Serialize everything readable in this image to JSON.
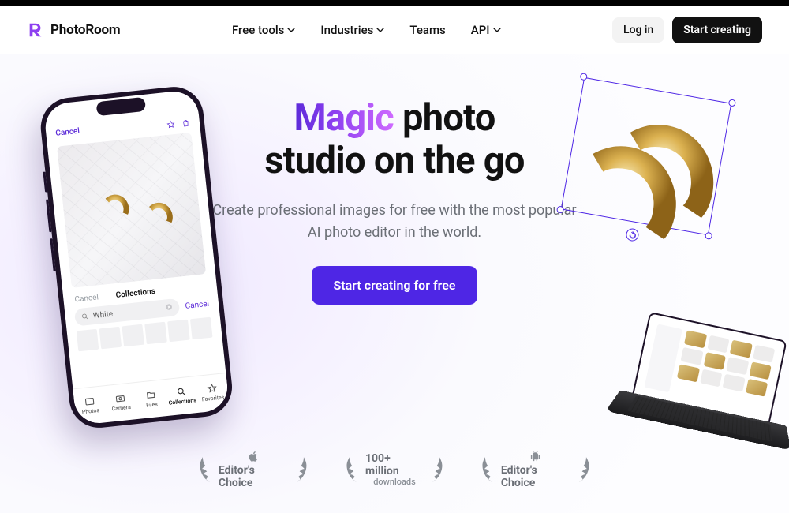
{
  "brand": {
    "name": "PhotoRoom"
  },
  "nav": {
    "items": [
      {
        "label": "Free tools",
        "dropdown": true
      },
      {
        "label": "Industries",
        "dropdown": true
      },
      {
        "label": "Teams",
        "dropdown": false
      },
      {
        "label": "API",
        "dropdown": true
      }
    ]
  },
  "auth": {
    "login": "Log in",
    "signup": "Start creating"
  },
  "hero": {
    "headline_accent": "Magic",
    "headline_rest_a": " photo",
    "headline_rest_b": "studio on the go",
    "sub_a": "Create professional images for free with the most popular",
    "sub_b": "AI photo editor in the world.",
    "cta": "Start creating for free"
  },
  "phone": {
    "cancel": "Cancel",
    "tab_a": "Cancel",
    "tab_b": "Collections",
    "search_value": "White",
    "search_trailing": "Cancel",
    "nav_items": [
      "Photos",
      "Camera",
      "Files",
      "Collections",
      "Favorites"
    ]
  },
  "badges": {
    "apple": "Editor's Choice",
    "downloads_top": "100+ million",
    "downloads_bot": "downloads",
    "android": "Editor's Choice"
  },
  "colors": {
    "cta": "#4e26e5",
    "gradient_from": "#5b2ad8",
    "gradient_to": "#cf6bff"
  }
}
